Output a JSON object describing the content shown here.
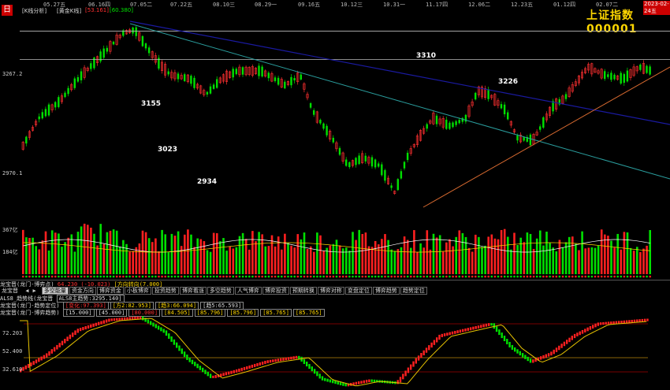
{
  "toolbar": {
    "logo": "日",
    "kline_label": "[K线分析]",
    "gold_label": "[黄金K线]",
    "val1": "[53.161]",
    "val2": "[60.380]"
  },
  "dates": [
    "05.27五",
    "06.16四",
    "07.05二",
    "07.22五",
    "08.10三",
    "08.29一",
    "09.16五",
    "10.12三",
    "10.31一",
    "11.17四",
    "12.06二",
    "12.23五",
    "01.12四",
    "02.07二"
  ],
  "last_date": "2023-02-24五",
  "index": {
    "name": "上证指数",
    "code": "000001"
  },
  "price_axis": {
    "top": "3267.2",
    "bottom": "2970.1"
  },
  "levels": [
    {
      "label": "3310",
      "value": 3310
    },
    {
      "label": "3226",
      "value": 3226
    },
    {
      "label": "3155",
      "value": 3155
    },
    {
      "label": "3023",
      "value": 3023
    },
    {
      "label": "2934",
      "value": 2934
    }
  ],
  "volume_axis": {
    "top": "367亿",
    "bottom": "184亿"
  },
  "strip1": {
    "name": "龙宝晋(龙门-博弈点)",
    "v1": "64.230 (-10.023)",
    "v2": "[方向转向(7.000]"
  },
  "tabs": [
    "多空能量",
    "资金方向",
    "博弈资金",
    "小板博弈",
    "投资趋势",
    "博弈看涨",
    "多空趋势",
    "人气博弈",
    "博弈投资",
    "预期转换",
    "博弈对称",
    "变盘定位",
    "博弈趋势",
    "趋势定位"
  ],
  "tabs_prefix": "龙宝晋",
  "strip3": {
    "name": "ALS8_趋势线(龙宝晋",
    "v": "ALS8主趋势:3295.140]"
  },
  "strip4": {
    "name": "龙宝晋(龙门-趋势定位)",
    "vals": [
      "[变化:97.393]",
      "[方2:82.953]",
      "[趋3:66.094]",
      "[趋5:65.593]"
    ]
  },
  "strip5": {
    "name": "龙宝晋(龙门-博弈趋势)",
    "vals": [
      "[15.000]",
      "[45.000]",
      "[80.000]",
      "[84.505]",
      "[85.796]",
      "[85.796]",
      "[85.765]",
      "[85.765]"
    ]
  },
  "osc_axis": [
    "72.203",
    "52.400",
    "32.610"
  ],
  "colors": {
    "up": "#ff3030",
    "down": "#00e000",
    "trend_blue": "#1a1aa0",
    "trend_cyan": "#2a9d9d",
    "trend_orange": "#d86a30"
  }
}
